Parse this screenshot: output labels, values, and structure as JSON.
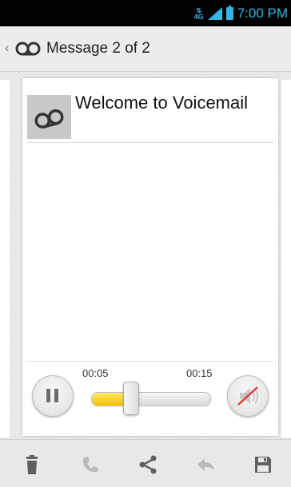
{
  "status_bar": {
    "network": "4G",
    "time": "7:00 PM",
    "signal_icon": "signal-icon",
    "battery_icon": "battery-icon"
  },
  "action_bar": {
    "title": "Message 2 of 2",
    "app_icon": "voicemail-icon",
    "up_icon": "chevron-left-icon"
  },
  "message": {
    "title": "Welcome to Voicemail",
    "contact_icon": "voicemail-icon"
  },
  "player": {
    "elapsed": "00:05",
    "duration": "00:15",
    "progress": 0.33,
    "pause_icon": "pause-icon",
    "speaker_icon": "speaker-muted-icon"
  },
  "bottom_actions": [
    {
      "name": "delete",
      "icon": "trash-icon",
      "enabled": true
    },
    {
      "name": "call",
      "icon": "phone-icon",
      "enabled": false
    },
    {
      "name": "share",
      "icon": "share-icon",
      "enabled": true
    },
    {
      "name": "reply",
      "icon": "reply-icon",
      "enabled": false
    },
    {
      "name": "save",
      "icon": "save-icon",
      "enabled": true
    }
  ],
  "colors": {
    "accent": "#33b5e5",
    "progress": "#f2c400",
    "icon_enabled": "#5f5f5f",
    "icon_disabled": "#b9b9b9"
  }
}
